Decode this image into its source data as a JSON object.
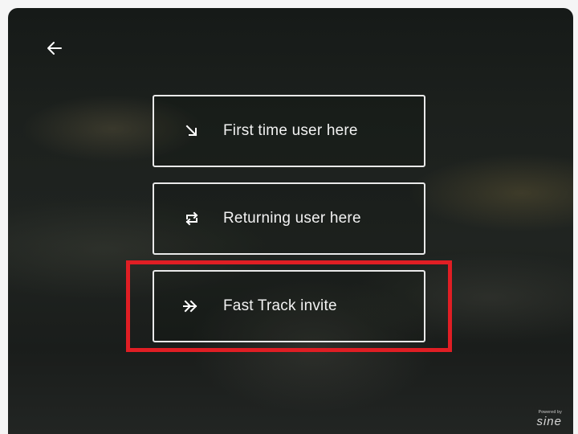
{
  "nav": {
    "back_icon": "back-arrow-icon"
  },
  "options": [
    {
      "label": "First time user here",
      "icon": "arrow-down-right-icon"
    },
    {
      "label": "Returning user here",
      "icon": "repeat-icon"
    },
    {
      "label": "Fast Track invite",
      "icon": "double-chevron-right-icon"
    }
  ],
  "highlight": {
    "color": "#e01e24",
    "target": "Fast Track invite"
  },
  "brand": {
    "powered_by": "Powered by",
    "logo": "sine"
  }
}
